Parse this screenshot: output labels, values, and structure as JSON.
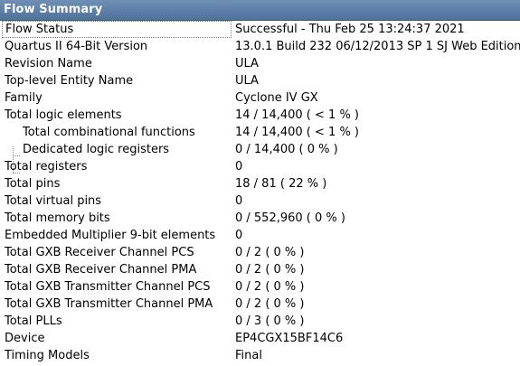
{
  "panel": {
    "title": "Flow Summary"
  },
  "rows": [
    {
      "name": "Flow Status",
      "value": "Successful - Thu Feb 25 13:24:37 2021"
    },
    {
      "name": "Quartus II 64-Bit Version",
      "value": "13.0.1 Build 232 06/12/2013 SP 1 SJ Web Edition"
    },
    {
      "name": "Revision Name",
      "value": "ULA"
    },
    {
      "name": "Top-level Entity Name",
      "value": "ULA"
    },
    {
      "name": "Family",
      "value": "Cyclone IV GX"
    },
    {
      "name": "Total logic elements",
      "value": "14 / 14,400 ( < 1 % )"
    },
    {
      "name": "Total combinational functions",
      "value": "14 / 14,400 ( < 1 % )"
    },
    {
      "name": "Dedicated logic registers",
      "value": "0 / 14,400 ( 0 % )"
    },
    {
      "name": "Total registers",
      "value": "0"
    },
    {
      "name": "Total pins",
      "value": "18 / 81 ( 22 % )"
    },
    {
      "name": "Total virtual pins",
      "value": "0"
    },
    {
      "name": "Total memory bits",
      "value": "0 / 552,960 ( 0 % )"
    },
    {
      "name": "Embedded Multiplier 9-bit elements",
      "value": "0"
    },
    {
      "name": "Total GXB Receiver Channel PCS",
      "value": "0 / 2 ( 0 % )"
    },
    {
      "name": "Total GXB Receiver Channel PMA",
      "value": "0 / 2 ( 0 % )"
    },
    {
      "name": "Total GXB Transmitter Channel PCS",
      "value": "0 / 2 ( 0 % )"
    },
    {
      "name": "Total GXB Transmitter Channel PMA",
      "value": "0 / 2 ( 0 % )"
    },
    {
      "name": "Total PLLs",
      "value": "0 / 3 ( 0 % )"
    },
    {
      "name": "Device",
      "value": "EP4CGX15BF14C6"
    },
    {
      "name": "Timing Models",
      "value": "Final"
    }
  ],
  "colors": {
    "header_bg": "#5a7ba5",
    "header_text": "#ffffff",
    "background": "#ffffff",
    "text": "#000000"
  }
}
